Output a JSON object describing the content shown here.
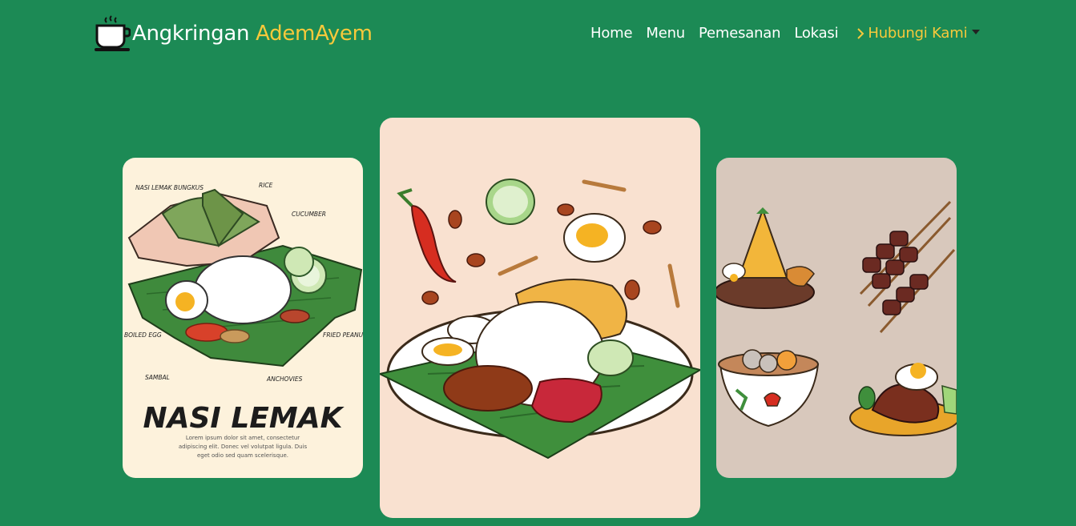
{
  "brand": {
    "name_part1": "Angkringan ",
    "name_part2": "AdemAyem",
    "icon": "coffee-cup-icon"
  },
  "nav": {
    "links": [
      "Home",
      "Menu",
      "Pemesanan",
      "Lokasi"
    ],
    "dropdown_label": "Hubungi Kami",
    "dropdown_icon": "chevron-right-icon"
  },
  "colors": {
    "background": "#1c8a55",
    "accent": "#f7c93b",
    "text": "#ffffff"
  },
  "cards": {
    "left": {
      "title": "NASI LEMAK",
      "labels": {
        "bungkus": "NASI LEMAK BUNGKUS",
        "rice": "RICE",
        "cucumber": "CUCUMBER",
        "egg": "BOILED EGG",
        "peanuts": "FRIED PEANUTS",
        "sambal": "SAMBAL",
        "anchovies": "ANCHOVIES"
      },
      "body_line1": "Lorem ipsum dolor sit amet, consectetur",
      "body_line2": "adipiscing elit. Donec vel volutpat ligula. Duis",
      "body_line3": "eget odio sed quam scelerisque."
    },
    "center": {
      "illustration": "nasi-lemak-plate"
    },
    "right": {
      "illustration": "indonesian-food-set"
    }
  }
}
